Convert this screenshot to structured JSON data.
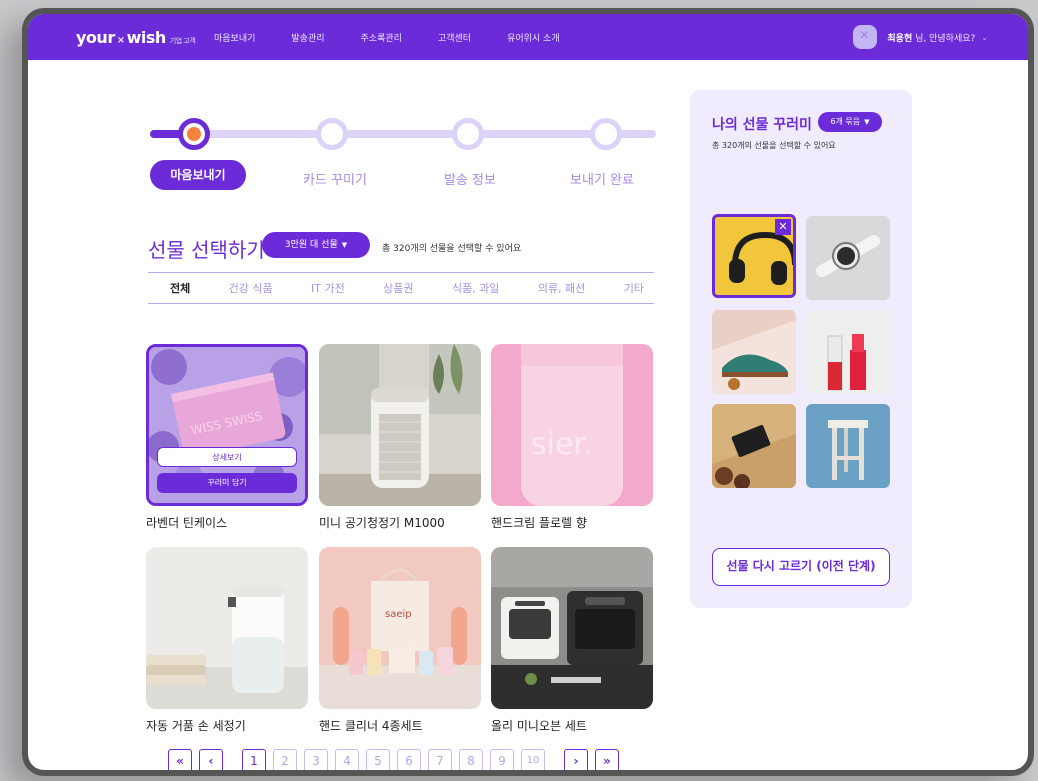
{
  "header": {
    "logo_main": "your",
    "logo_x": "×",
    "logo_wish": "wish",
    "logo_sub": "기업 고객",
    "nav": [
      "마음보내기",
      "발송관리",
      "주소록관리",
      "고객센터",
      "유어위시 소개"
    ],
    "user_name": "최용현",
    "user_greeting": " 님, 안녕하세요?",
    "chevron": "⌄"
  },
  "steps": [
    "마음보내기",
    "카드 꾸미기",
    "발송 정보",
    "보내기 완료"
  ],
  "gift_section": {
    "title": "선물 선택하기",
    "price_filter": "3만원 대 선물",
    "caret": "▼",
    "subtitle": "총 320개의 선물을 선택할 수 있어요",
    "tabs": [
      "전체",
      "건강 식품",
      "IT 가전",
      "상품권",
      "식품, 과일",
      "의류, 패션",
      "기타"
    ],
    "products": [
      "라벤더 틴케이스",
      "미니 공기청정기 M1000",
      "핸드크림 플로렐 향",
      "자동 거품 손 세정기",
      "핸드 클리너 4종세트",
      "올리 미니오븐 세트"
    ],
    "overlay_detail": "상세보기",
    "overlay_add": "꾸러미 담기",
    "tin_text": "WISS SWISS",
    "bottle_text": "sier.",
    "bag_text": "saeip"
  },
  "pagination": {
    "first": "«",
    "prev": "‹",
    "pages": [
      "1",
      "2",
      "3",
      "4",
      "5",
      "6",
      "7",
      "8",
      "9",
      "10"
    ],
    "next": "›",
    "last": "»"
  },
  "bundle_panel": {
    "title": "나의 선물 꾸러미",
    "count_label": "6개 묶음",
    "caret": "▼",
    "subtitle": "총 320개의 선물을 선택할 수 있어요",
    "remove_glyph": "✕",
    "reset_button": "선물 다시 고르기 (이전 단계)"
  },
  "colors": {
    "brand": "#6c2bd9",
    "brand_light": "#ddd2f7",
    "panel_bg": "#f1ecfd",
    "step_current_dot": "#f5823a"
  }
}
